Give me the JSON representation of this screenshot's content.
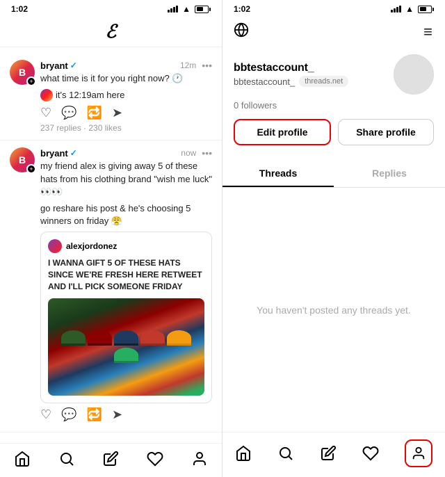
{
  "left": {
    "time": "1:02",
    "logo": "@",
    "posts": [
      {
        "username": "bryant",
        "verified": true,
        "time_ago": "12m",
        "question": "what time is it for you right now? 🕐",
        "reply_text": "it's 12:19am here",
        "stats": "237 replies · 230 likes"
      },
      {
        "username": "bryant",
        "verified": true,
        "time_ago": "now",
        "text1": "my friend alex is giving away 5 of these hats from his clothing brand \"wish me luck\" 👀👀",
        "text2": "go reshare his post & he's choosing 5 winners on friday 😤",
        "inner_username": "alexjordonez",
        "inner_text": "I WANNA GIFT 5 OF THESE HATS SINCE WE'RE FRESH HERE RETWEET AND I'LL PICK SOMEONE FRIDAY"
      }
    ],
    "nav": {
      "home": "⌂",
      "search": "⌕",
      "compose": "↺",
      "heart": "♡",
      "profile": "👤"
    }
  },
  "right": {
    "time": "1:02",
    "globe_icon": "🌐",
    "menu_icon": "≡",
    "profile": {
      "username": "bbtestaccount_",
      "handle": "bbtestaccount_",
      "domain": "threads.net",
      "followers": "0 followers",
      "edit_label": "Edit profile",
      "share_label": "Share profile"
    },
    "tabs": [
      {
        "label": "Threads",
        "active": true
      },
      {
        "label": "Replies",
        "active": false
      }
    ],
    "empty_state": "You haven't posted any threads yet.",
    "nav": {
      "home": "⌂",
      "search": "⌕",
      "compose": "↺",
      "heart": "♡",
      "profile": "👤"
    }
  }
}
